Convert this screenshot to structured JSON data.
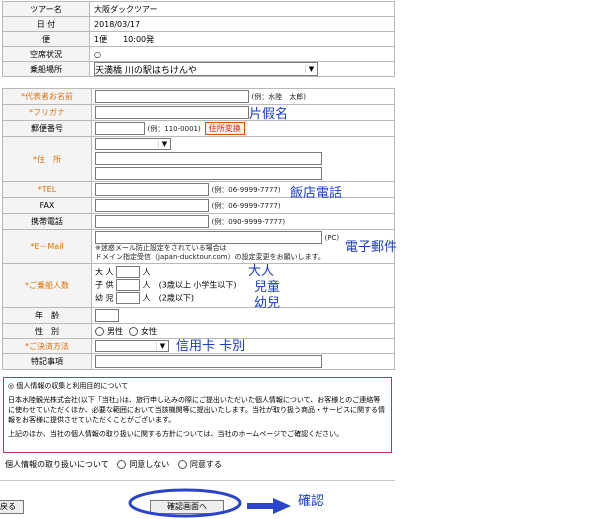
{
  "tour_info": {
    "rows": [
      {
        "label": "ツアー名",
        "value": "大阪ダックツアー"
      },
      {
        "label": "日 付",
        "value": "2018/03/17"
      },
      {
        "label": "便",
        "value": "1便　　10:00発"
      },
      {
        "label": "空席状況",
        "value": "○"
      },
      {
        "label": "乗船場所",
        "value": "天満橋 川の駅はちけんや"
      }
    ]
  },
  "form": {
    "rep_name": {
      "label": "*代表者お名前",
      "example": "(例：水陸　太郎)"
    },
    "furigana": {
      "label": "*フリガナ"
    },
    "zip": {
      "label": "郵便番号",
      "example": "(例：110-0001)",
      "convert_button": "住所変換"
    },
    "address": {
      "label": "*住　所"
    },
    "tel": {
      "label": "*TEL",
      "example": "(例：06-9999-7777)"
    },
    "fax": {
      "label": "FAX",
      "example": "(例：06-9999-7777)"
    },
    "mobile": {
      "label": "携帯電話",
      "example": "(例：090-9999-7777)"
    },
    "email": {
      "label": "*E－Mail",
      "pc_note": "(PC)",
      "note1": "※迷惑メール防止設定をされている場合は",
      "note2": "ドメイン指定受信（japan-ducktour.com）の設定変更をお願いします。"
    },
    "passengers": {
      "label": "*ご乗船人数",
      "adult": "大 人",
      "adult_unit": "人",
      "child": "子 供",
      "child_unit": "人　(3歳以上 小学生以下)",
      "infant": "幼 児",
      "infant_unit": "人　(2歳以下)"
    },
    "age": {
      "label": "年　齢"
    },
    "gender": {
      "label": "性　別",
      "male": "男性",
      "female": "女性"
    },
    "payment": {
      "label": "*ご決済方法"
    },
    "remarks": {
      "label": "特記事項"
    }
  },
  "privacy": {
    "title": "◎ 個人情報の収集と利用目的について",
    "body1": "日本水陸観光株式会社(以下「当社」)は、旅行申し込みの際にご提出いただいた個人情報について、お客様とのご連絡等に使わせていただくほか、必要な範囲において当該機関等に提出いたします。当社が取り扱う商品・サービスに関する情報をお客様に提供させていただくことがございます。",
    "body2": "上記のほか、当社の個人情報の取り扱いに関する方針については、当社のホームページでご確認ください。",
    "consent_label": "個人情報の取り扱いについて",
    "disagree": "同意しない",
    "agree": "同意する"
  },
  "buttons": {
    "back": "戻る",
    "confirm": "確認画面へ"
  },
  "annotations": {
    "furigana": "片假名",
    "tel": "飯店電話",
    "email": "電子郵件",
    "adult": "大人",
    "child": "兒童",
    "infant": "幼兒",
    "payment": "信用卡 卡別",
    "confirm": "確認"
  },
  "colors": {
    "annotation_blue": "#1a3ccc",
    "required_orange": "#e07000",
    "privacy_border": "#c03060",
    "oval_blue": "#2a44cc"
  }
}
